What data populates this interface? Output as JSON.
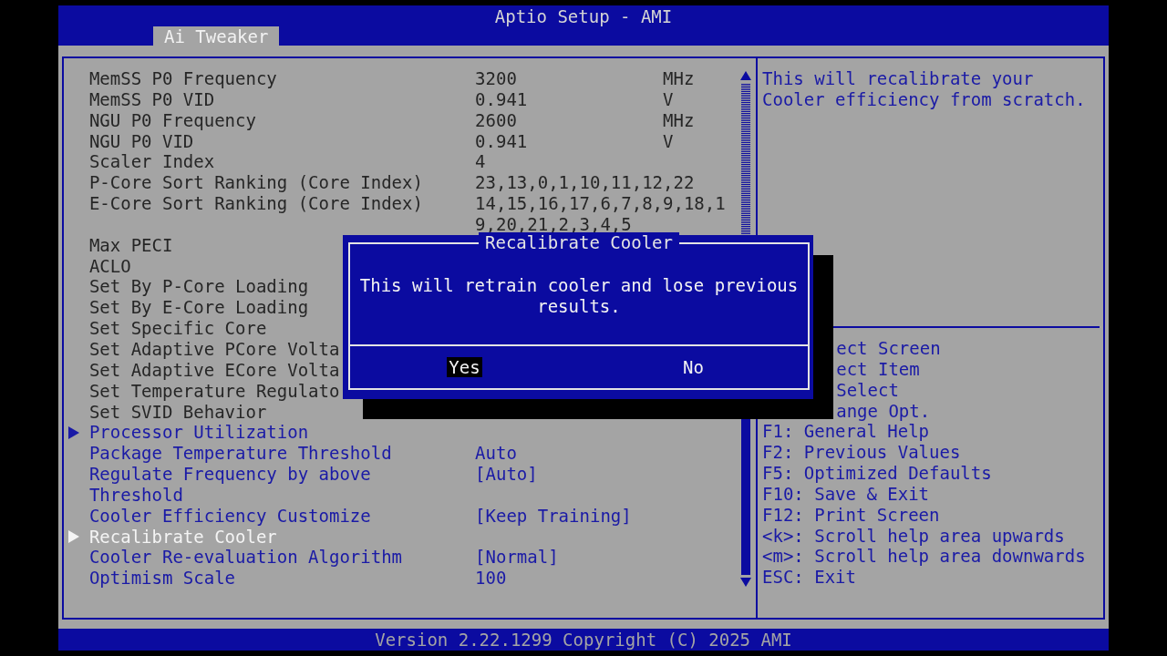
{
  "window": {
    "title": "Aptio Setup - AMI"
  },
  "tabs": [
    {
      "label": "Ai Tweaker",
      "selected": true
    }
  ],
  "settings": [
    {
      "kind": "info",
      "label": "MemSS P0 Frequency",
      "value": "3200",
      "unit": "MHz",
      "selected": false
    },
    {
      "kind": "info",
      "label": "MemSS P0 VID",
      "value": "0.941",
      "unit": "V",
      "selected": false
    },
    {
      "kind": "info",
      "label": "NGU P0 Frequency",
      "value": "2600",
      "unit": "MHz",
      "selected": false
    },
    {
      "kind": "info",
      "label": "NGU P0 VID",
      "value": "0.941",
      "unit": "V",
      "selected": false
    },
    {
      "kind": "info",
      "label": "Scaler Index",
      "value": "4",
      "selected": false
    },
    {
      "kind": "info",
      "label": "P-Core Sort Ranking (Core Index)",
      "value": "23,13,0,1,10,11,12,22",
      "selected": false
    },
    {
      "kind": "info",
      "label": "E-Core Sort Ranking (Core Index)",
      "value": "14,15,16,17,6,7,8,9,18,19,20,21,2,3,4,5",
      "selected": false
    },
    {
      "kind": "info",
      "label": "Max PECI",
      "selected": false
    },
    {
      "kind": "info",
      "label": "ACLO",
      "selected": false
    },
    {
      "kind": "info",
      "label": "Set By P-Core Loading",
      "selected": false
    },
    {
      "kind": "info",
      "label": "Set By E-Core Loading",
      "selected": false
    },
    {
      "kind": "info",
      "label": "Set Specific Core",
      "selected": false
    },
    {
      "kind": "info",
      "label": "Set Adaptive PCore Volta",
      "selected": false
    },
    {
      "kind": "info",
      "label": "Set Adaptive ECore Volta",
      "selected": false
    },
    {
      "kind": "info",
      "label": "Set Temperature Regulato",
      "selected": false
    },
    {
      "kind": "info",
      "label": "Set SVID Behavior",
      "selected": false
    },
    {
      "kind": "submenu",
      "label": "Processor Utilization",
      "selected": false
    },
    {
      "kind": "item",
      "label": "Package Temperature Threshold",
      "value": "Auto",
      "selected": false
    },
    {
      "kind": "item",
      "label": "Regulate Frequency by above Threshold",
      "value": "[Auto]",
      "selected": false
    },
    {
      "kind": "item",
      "label": "Cooler Efficiency Customize",
      "value": "[Keep Training]",
      "selected": false
    },
    {
      "kind": "submenu",
      "label": "Recalibrate Cooler",
      "selected": true
    },
    {
      "kind": "item",
      "label": "Cooler Re-evaluation Algorithm",
      "value": "[Normal]",
      "selected": false
    },
    {
      "kind": "item",
      "label": "Optimism Scale",
      "value": "100",
      "selected": false
    }
  ],
  "help_text": "This will recalibrate your Cooler efficiency from scratch.",
  "key_help": [
    {
      "kind": "covered",
      "text": "ect Screen"
    },
    {
      "kind": "covered",
      "text": "ect Item"
    },
    {
      "kind": "covered",
      "text": "Select"
    },
    {
      "kind": "covered",
      "text": "ange Opt."
    },
    {
      "kind": "plain",
      "text": "F1: General Help"
    },
    {
      "kind": "plain",
      "text": "F2: Previous Values"
    },
    {
      "kind": "plain",
      "text": "F5: Optimized Defaults"
    },
    {
      "kind": "plain",
      "text": "F10: Save & Exit"
    },
    {
      "kind": "plain",
      "text": "F12: Print Screen"
    },
    {
      "kind": "plain",
      "text": "<k>: Scroll help area upwards"
    },
    {
      "kind": "plain",
      "text": "<m>: Scroll help area downwards"
    },
    {
      "kind": "plain",
      "text": "ESC: Exit"
    }
  ],
  "dialog": {
    "title": "Recalibrate Cooler",
    "message": "This will retrain cooler and lose previous results.",
    "buttons": [
      {
        "label": "Yes",
        "selected": true
      },
      {
        "label": "No",
        "selected": false
      }
    ]
  },
  "status_bar": "Version 2.22.1299 Copyright (C) 2025 AMI"
}
